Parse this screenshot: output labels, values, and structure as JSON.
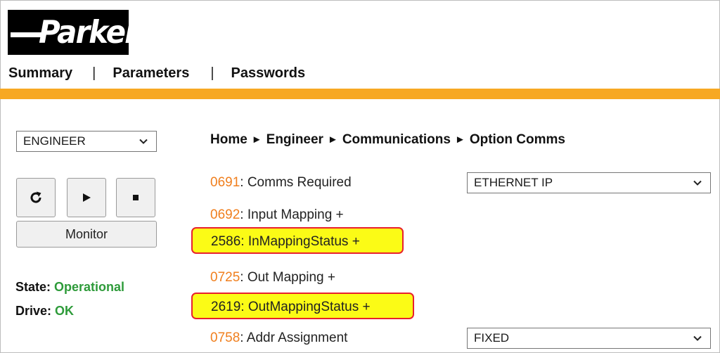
{
  "brand": {
    "logo_text": "Parker"
  },
  "nav": {
    "summary": "Summary",
    "parameters": "Parameters",
    "passwords": "Passwords",
    "separator": "|"
  },
  "left": {
    "level_select": "ENGINEER",
    "buttons": {
      "refresh": "refresh-icon",
      "run": "play-icon",
      "stop": "stop-icon"
    },
    "monitor_label": "Monitor",
    "state_label": "State:",
    "state_value": "Operational",
    "drive_label": "Drive:",
    "drive_value": "OK"
  },
  "breadcrumb": [
    "Home",
    "Engineer",
    "Communications",
    "Option Comms"
  ],
  "breadcrumb_separator": "►",
  "params": [
    {
      "num": "0691",
      "label": ": Comms Required",
      "value": "ETHERNET IP"
    },
    {
      "num": "0692",
      "label": ": Input Mapping +"
    },
    {
      "num": "2586",
      "label": ": InMappingStatus +",
      "highlighted": true
    },
    {
      "num": "0725",
      "label": ": Out Mapping +"
    },
    {
      "num": "2619",
      "label": ": OutMappingStatus +",
      "highlighted": true
    },
    {
      "num": "0758",
      "label": ": Addr Assignment",
      "value": "FIXED"
    }
  ],
  "colors": {
    "accent_bar": "#f7a823",
    "param_number": "#f07f1e",
    "status_ok": "#2e9b3a",
    "highlight": "#fbfb16",
    "highlight_border": "#e8202e"
  }
}
